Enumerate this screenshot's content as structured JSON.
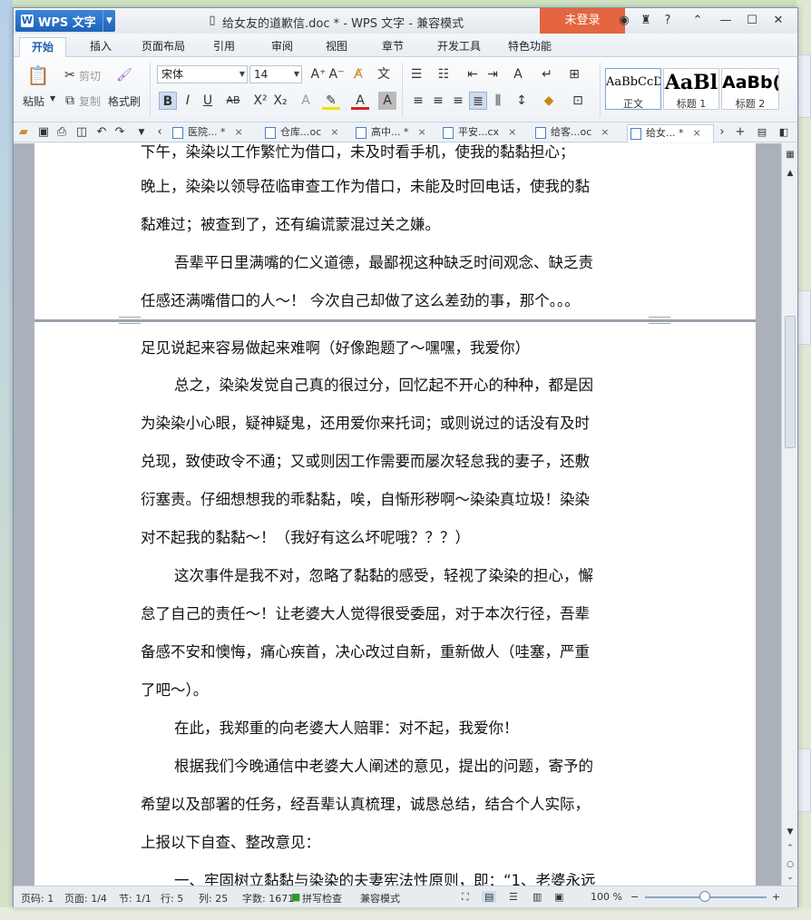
{
  "app": {
    "name": "WPS 文字",
    "login": "未登录",
    "title": "给女友的道歉信.doc * - WPS 文字 - 兼容模式"
  },
  "menu_tabs": [
    "开始",
    "插入",
    "页面布局",
    "引用",
    "审阅",
    "视图",
    "章节",
    "开发工具",
    "特色功能"
  ],
  "ribbon": {
    "paste": "粘贴",
    "cut": "剪切",
    "copy": "复制",
    "format_painter": "格式刷",
    "font": "宋体",
    "size": "14",
    "styles": [
      {
        "preview": "AaBbCcD",
        "label": "正文"
      },
      {
        "preview": "AaBl",
        "label": "标题 1"
      },
      {
        "preview": "AaBb(",
        "label": "标题 2"
      }
    ]
  },
  "doc_tabs": [
    {
      "label": "医院... *",
      "active": false
    },
    {
      "label": "仓库...oc",
      "active": false
    },
    {
      "label": "高中... *",
      "active": false
    },
    {
      "label": "平安...cx",
      "active": false
    },
    {
      "label": "给客...oc",
      "active": false
    },
    {
      "label": "给女... *",
      "active": true
    }
  ],
  "document": {
    "page1_lines": [
      "下午，染染以工作繁忙为借口，未及时看手机，使我的黏黏担心；",
      "晚上，染染以领导莅临审查工作为借口，未能及时回电话，使我的黏",
      "黏难过；被查到了，还有编谎蒙混过关之嫌。",
      "吾辈平日里满嘴的仁义道德，最鄙视这种缺乏时间观念、缺乏责",
      "任感还满嘴借口的人～！ 今次自己却做了这么差劲的事，那个。。。"
    ],
    "page2_lines": [
      "足见说起来容易做起来难啊（好像跑题了～嘿嘿，我爱你）",
      "总之，染染发觉自己真的很过分，回忆起不开心的种种，都是因",
      "为染染小心眼，疑神疑鬼，还用爱你来托词；或则说过的话没有及时",
      "兑现，致使政令不通；又或则因工作需要而屡次轻怠我的妻子，还敷",
      "衍塞责。仔细想想我的乖黏黏，唉，自惭形秽啊～染染真垃圾！染染",
      "对不起我的黏黏～！（我好有这么坏呢哦？？？）",
      "这次事件是我不对，忽略了黏黏的感受，轻视了染染的担心，懈",
      "怠了自己的责任～！让老婆大人觉得很受委屈，对于本次行径，吾辈",
      "备感不安和懊悔，痛心疾首，决心改过自新，重新做人（哇塞，严重",
      "了吧～）。",
      "在此，我郑重的向老婆大人赔罪：对不起，我爱你！",
      "根据我们今晚通信中老婆大人阐述的意见，提出的问题，寄予的",
      "希望以及部署的任务，经吾辈认真梳理，诚恳总结，结合个人实际，",
      "上报以下自查、整改意见：",
      "一、牢固树立黏黏与染染的夫妻宪法性原则，即：“1、老婆永远"
    ]
  },
  "status": {
    "page_num": "页码: 1",
    "page": "页面: 1/4",
    "section": "节: 1/1",
    "row": "行: 5",
    "col": "列: 25",
    "words": "字数: 1671",
    "spell": "拼写检查",
    "mode": "兼容模式",
    "zoom": "100 %"
  }
}
